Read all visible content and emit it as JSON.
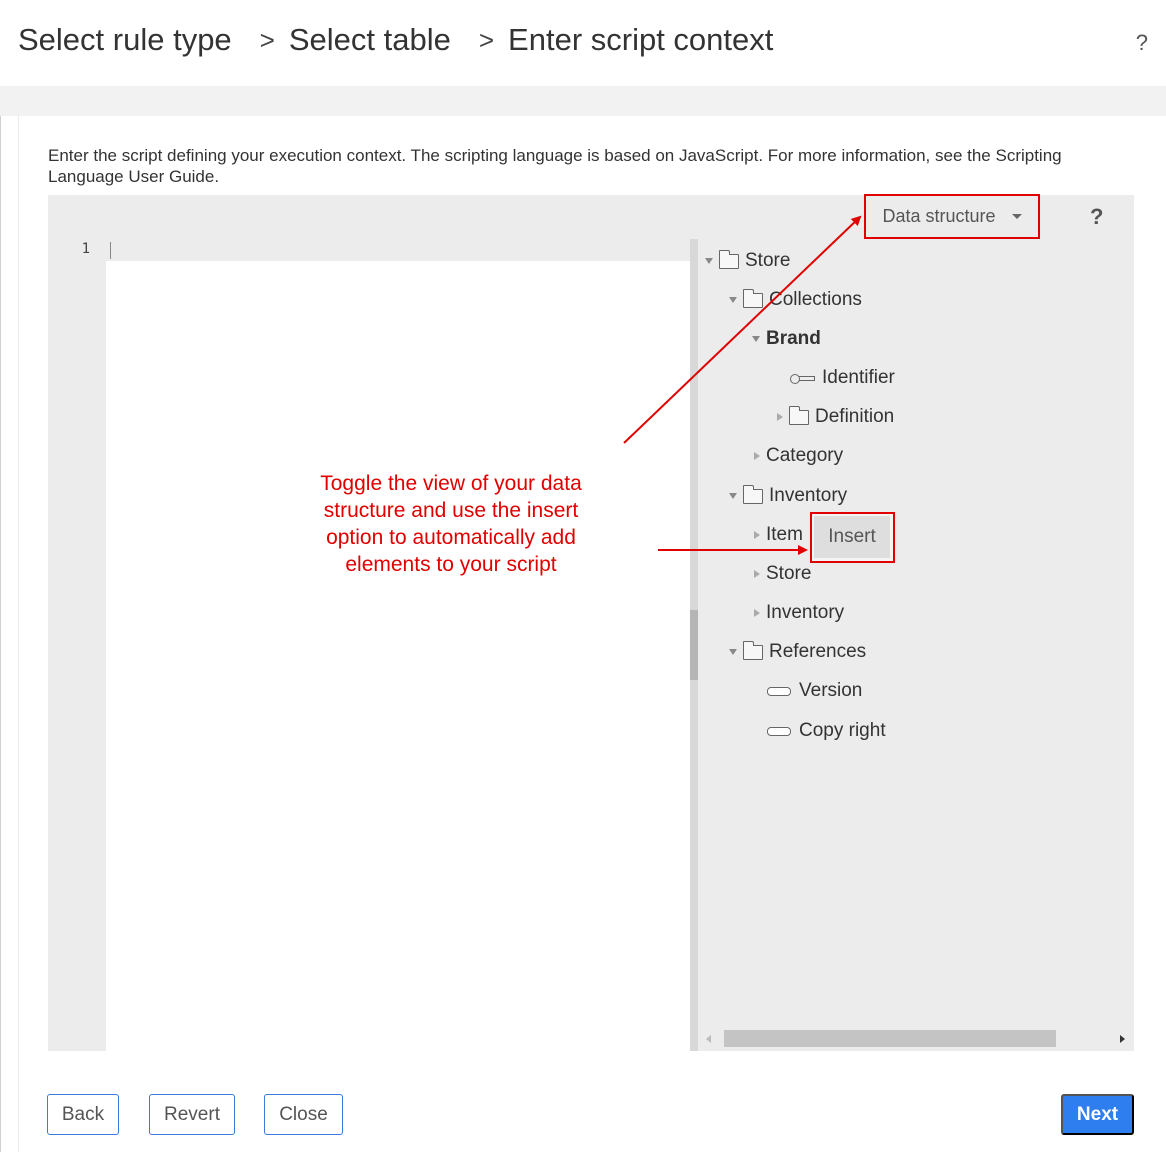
{
  "breadcrumb": {
    "steps": [
      "Select rule type",
      "Select table",
      "Enter script context"
    ],
    "separator": ">",
    "help": "?"
  },
  "intro_text": "Enter the script defining your execution context. The scripting language is based on JavaScript. For more information, see the Scripting Language User Guide.",
  "editor": {
    "line_number": "1",
    "toolbar": {
      "data_structure_label": "Data structure",
      "help": "?"
    }
  },
  "tree": {
    "store": "Store",
    "collections": "Collections",
    "brand": "Brand",
    "identifier": "Identifier",
    "definition": "Definition",
    "category": "Category",
    "inventory": "Inventory",
    "item": "Item",
    "insert_label": "Insert",
    "store_child": "Store",
    "inventory_child": "Inventory",
    "references": "References",
    "version": "Version",
    "copy_right": "Copy right"
  },
  "annotation": {
    "text": "Toggle the view of your data structure and use the insert option to automatically add elements to your script",
    "color": "#e00000"
  },
  "footer": {
    "back": "Back",
    "revert": "Revert",
    "close": "Close",
    "next": "Next"
  },
  "colors": {
    "primary": "#2f7ef0",
    "highlight": "#e00000"
  }
}
